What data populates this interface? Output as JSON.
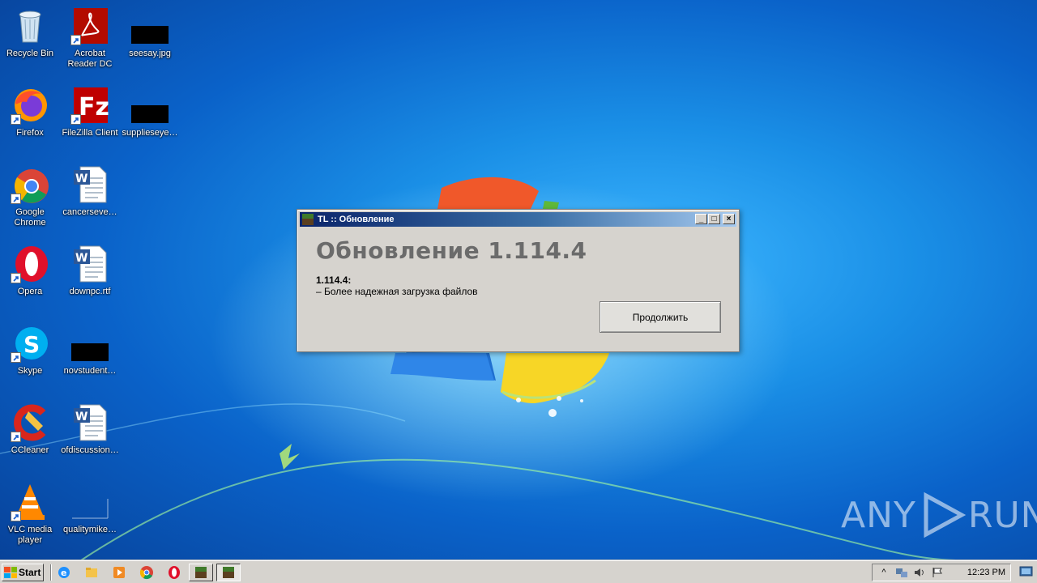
{
  "desktop": {
    "icons": [
      {
        "label": "Recycle Bin",
        "icon": "recycle-bin-icon"
      },
      {
        "label": "Acrobat Reader DC",
        "icon": "acrobat-icon"
      },
      {
        "label": "seesay.jpg",
        "icon": "image-file-icon"
      },
      {
        "label": "Firefox",
        "icon": "firefox-icon"
      },
      {
        "label": "FileZilla Client",
        "icon": "filezilla-icon"
      },
      {
        "label": "supplieseye…",
        "icon": "image-file-icon"
      },
      {
        "label": "Google Chrome",
        "icon": "chrome-icon"
      },
      {
        "label": "cancerseve…",
        "icon": "word-doc-icon"
      },
      {
        "label": "Opera",
        "icon": "opera-icon"
      },
      {
        "label": "downpc.rtf",
        "icon": "word-doc-icon"
      },
      {
        "label": "Skype",
        "icon": "skype-icon"
      },
      {
        "label": "novstudent…",
        "icon": "image-file-icon"
      },
      {
        "label": "CCleaner",
        "icon": "ccleaner-icon"
      },
      {
        "label": "ofdiscussion…",
        "icon": "word-doc-icon"
      },
      {
        "label": "VLC media player",
        "icon": "vlc-icon"
      },
      {
        "label": "qualitymike…",
        "icon": "blank-file-icon"
      }
    ]
  },
  "dialog": {
    "title": "TL :: Обновление",
    "heading": "Обновление 1.114.4",
    "version_line": "1.114.4:",
    "note": "– Более надежная загрузка файлов",
    "continue_label": "Продолжить",
    "minimize": "_",
    "maximize": "□",
    "close": "×"
  },
  "taskbar": {
    "start_label": "Start",
    "quick_launch": [
      "ie-icon",
      "explorer-icon",
      "media-player-icon",
      "chrome-icon",
      "opera-icon"
    ],
    "tasks": [
      "minecraft-launcher-icon",
      "minecraft-launcher-icon"
    ],
    "clock": "12:23 PM"
  },
  "watermark": {
    "text_left": "ANY",
    "text_right": "RUN"
  },
  "colors": {
    "dialog_bg": "#d6d3ce",
    "titlebar_start": "#0a246a",
    "titlebar_end": "#a6caf0",
    "heading": "#6b6b6b",
    "desktop": "#1a8fe6"
  }
}
